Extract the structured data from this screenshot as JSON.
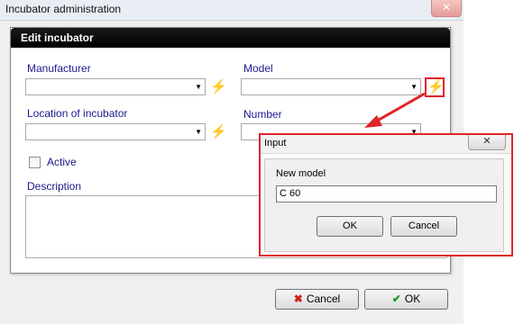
{
  "window": {
    "title": "Incubator administration"
  },
  "edit_dialog": {
    "title": "Edit incubator",
    "manufacturer": {
      "label": "Manufacturer",
      "value": ""
    },
    "model": {
      "label": "Model",
      "value": ""
    },
    "location": {
      "label": "Location of incubator",
      "value": ""
    },
    "number": {
      "label": "Number",
      "value": ""
    },
    "active": {
      "label": "Active",
      "checked": false
    },
    "description": {
      "label": "Description",
      "value": ""
    }
  },
  "buttons": {
    "cancel": "Cancel",
    "ok": "OK"
  },
  "input_dialog": {
    "title": "Input",
    "label": "New model",
    "value": "C 60",
    "ok": "OK",
    "cancel": "Cancel"
  },
  "icons": {
    "lookup": "lightning-bolt-icon",
    "close": "close-icon",
    "dropdown": "chevron-down-icon",
    "cancel": "red-x-icon",
    "ok": "green-checkmark-icon"
  },
  "colors": {
    "header_bg": "#000000",
    "label_text": "#1a1a8c",
    "highlight": "#e0242a",
    "bolt": "#e6c800"
  }
}
